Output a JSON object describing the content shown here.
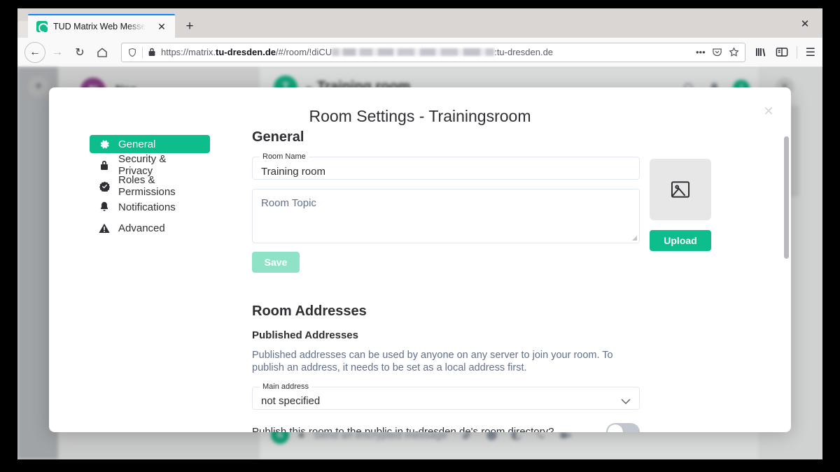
{
  "browser": {
    "tab": {
      "title": "TUD Matrix Web Messeng",
      "favicon": "matrix-logo-icon",
      "close_label": "✕"
    },
    "new_tab_label": "+",
    "window_close_label": "✕",
    "nav": {
      "back_label": "←",
      "forward_label": "→",
      "reload_label": "↻",
      "home_label": "⌂"
    },
    "url": {
      "scheme": "https://matrix.",
      "domain": "tu-dresden.de",
      "path_before": "/#/room/!diCU",
      "redacted": "",
      "path_after": ":tu-dresden.de",
      "shield_icon": "shield-icon",
      "lock_icon": "lock-icon",
      "more_label": "•••",
      "pocket_icon": "pocket-icon",
      "star_icon": "star-icon"
    },
    "toolbar_right": {
      "library_icon": "library-icon",
      "sidebar_icon": "sidebar-icon",
      "menu_label": "☰"
    }
  },
  "app": {
    "add_label": "+",
    "room_list": {
      "avatar_letter": "N",
      "name": "Noe",
      "options_label": "···"
    },
    "room_header": {
      "avatar_letter": "T",
      "title": "Training  room",
      "search_icon": "search-icon",
      "notifications_icon": "bell-icon",
      "info_label": "i"
    },
    "composer": {
      "avatar_letter": "N",
      "placeholder": "Send an encrypted message",
      "attach_icon": "paperclip-icon",
      "emoji_icon": "emoji-icon",
      "sticker_icon": "sticker-icon",
      "voice_icon": "phone-icon",
      "video_icon": "video-icon"
    },
    "right_panel": {
      "close_label": "✕",
      "chevron_label": "›"
    }
  },
  "dialog": {
    "title": "Room Settings - Trainingsroom",
    "close_label": "✕",
    "nav": [
      {
        "label": "General",
        "icon": "gear-icon",
        "active": true
      },
      {
        "label": "Security & Privacy",
        "icon": "lock-icon",
        "active": false
      },
      {
        "label": "Roles & Permissions",
        "icon": "badge-check-icon",
        "active": false
      },
      {
        "label": "Notifications",
        "icon": "bell-icon",
        "active": false
      },
      {
        "label": "Advanced",
        "icon": "warning-icon",
        "active": false
      }
    ],
    "general": {
      "heading": "General",
      "room_name_label": "Room Name",
      "room_name_value": "Training  room",
      "room_topic_placeholder": "Room Topic",
      "save_label": "Save",
      "upload_label": "Upload",
      "avatar_placeholder_icon": "image-icon"
    },
    "addresses": {
      "heading": "Room Addresses",
      "published_heading": "Published Addresses",
      "published_description": "Published addresses can be used by anyone on any server to join your room. To publish an address, it needs to be set as a local address first.",
      "main_address_label": "Main address",
      "main_address_value": "not specified",
      "main_address_chevron": "chevron-down-icon",
      "publish_question": "Publish this room to the public in tu-dresden.de's room directory?",
      "publish_enabled": false
    }
  },
  "colors": {
    "accent": "#0dbd8b",
    "accent_muted": "#8ee3c7",
    "text": "#2e2f32",
    "muted_text": "#61708c"
  }
}
